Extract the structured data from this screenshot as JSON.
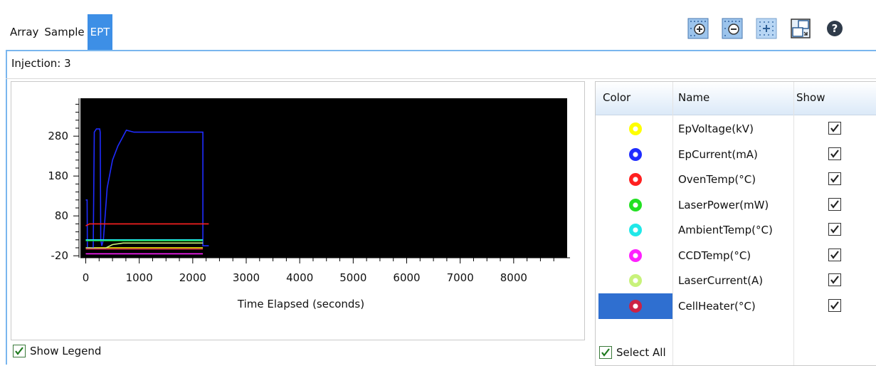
{
  "tabs": [
    {
      "label": "Array",
      "active": false
    },
    {
      "label": "Sample",
      "active": false
    },
    {
      "label": "EPT",
      "active": true
    }
  ],
  "toolbar": {
    "icons": [
      "zoom-in-icon",
      "zoom-out-icon",
      "fit-view-icon",
      "restore-window-icon",
      "help-icon"
    ]
  },
  "injection_label": "Injection: 3",
  "chart_data": {
    "type": "line",
    "xlabel": "Time Elapsed (seconds)",
    "ylabel": "",
    "xlim": [
      -100,
      9000
    ],
    "ylim": [
      -25,
      375
    ],
    "xticks": [
      0,
      1000,
      2000,
      3000,
      4000,
      5000,
      6000,
      7000,
      8000
    ],
    "yticks": [
      -20,
      80,
      180,
      280
    ],
    "background": "#000000",
    "series": [
      {
        "name": "EpVoltage(kV)",
        "color": "#ffff00",
        "x": [
          0,
          2190
        ],
        "y": [
          0,
          0
        ]
      },
      {
        "name": "EpCurrent(mA)",
        "color": "#1f2cff",
        "x": [
          0,
          25,
          30,
          140,
          160,
          200,
          210,
          260,
          270,
          280,
          300,
          330,
          400,
          500,
          600,
          700,
          760,
          900,
          2190,
          2190,
          2300
        ],
        "y": [
          120,
          120,
          0,
          0,
          290,
          298,
          298,
          298,
          290,
          20,
          5,
          20,
          150,
          220,
          255,
          280,
          295,
          290,
          290,
          5,
          5
        ]
      },
      {
        "name": "OvenTemp(°C)",
        "color": "#ff2020",
        "x": [
          0,
          70,
          2300
        ],
        "y": [
          55,
          60,
          60
        ]
      },
      {
        "name": "LaserPower(mW)",
        "color": "#22e022",
        "x": [
          0,
          2190
        ],
        "y": [
          18,
          18
        ]
      },
      {
        "name": "AmbientTemp(°C)",
        "color": "#20e8e8",
        "x": [
          0,
          2190
        ],
        "y": [
          20,
          20
        ]
      },
      {
        "name": "CCDTemp(°C)",
        "color": "#ff20ff",
        "x": [
          0,
          2190
        ],
        "y": [
          -15,
          -15
        ]
      },
      {
        "name": "LaserCurrent(A)",
        "color": "#c8f27a",
        "x": [
          0,
          350,
          500,
          700,
          2190
        ],
        "y": [
          0,
          -2,
          8,
          12,
          12
        ]
      },
      {
        "name": "CellHeater(°C)",
        "color": "#cc2244",
        "x": [
          0,
          2190
        ],
        "y": [
          -3,
          -3
        ]
      }
    ]
  },
  "legend_table": {
    "headers": {
      "color": "Color",
      "name": "Name",
      "show": "Show"
    },
    "rows": [
      {
        "name": "EpVoltage(kV)",
        "color": "#ffff00",
        "show": true,
        "selected": false
      },
      {
        "name": "EpCurrent(mA)",
        "color": "#1f2cff",
        "show": true,
        "selected": false
      },
      {
        "name": "OvenTemp(°C)",
        "color": "#ff2020",
        "show": true,
        "selected": false
      },
      {
        "name": "LaserPower(mW)",
        "color": "#22e022",
        "show": true,
        "selected": false
      },
      {
        "name": "AmbientTemp(°C)",
        "color": "#20e8e8",
        "show": true,
        "selected": false
      },
      {
        "name": "CCDTemp(°C)",
        "color": "#ff20ff",
        "show": true,
        "selected": false
      },
      {
        "name": "LaserCurrent(A)",
        "color": "#c8f27a",
        "show": true,
        "selected": false
      },
      {
        "name": "CellHeater(°C)",
        "color": "#cc2244",
        "show": true,
        "selected": true
      }
    ]
  },
  "show_legend": {
    "label": "Show Legend",
    "checked": true
  },
  "select_all": {
    "label": "Select All",
    "checked": true
  }
}
